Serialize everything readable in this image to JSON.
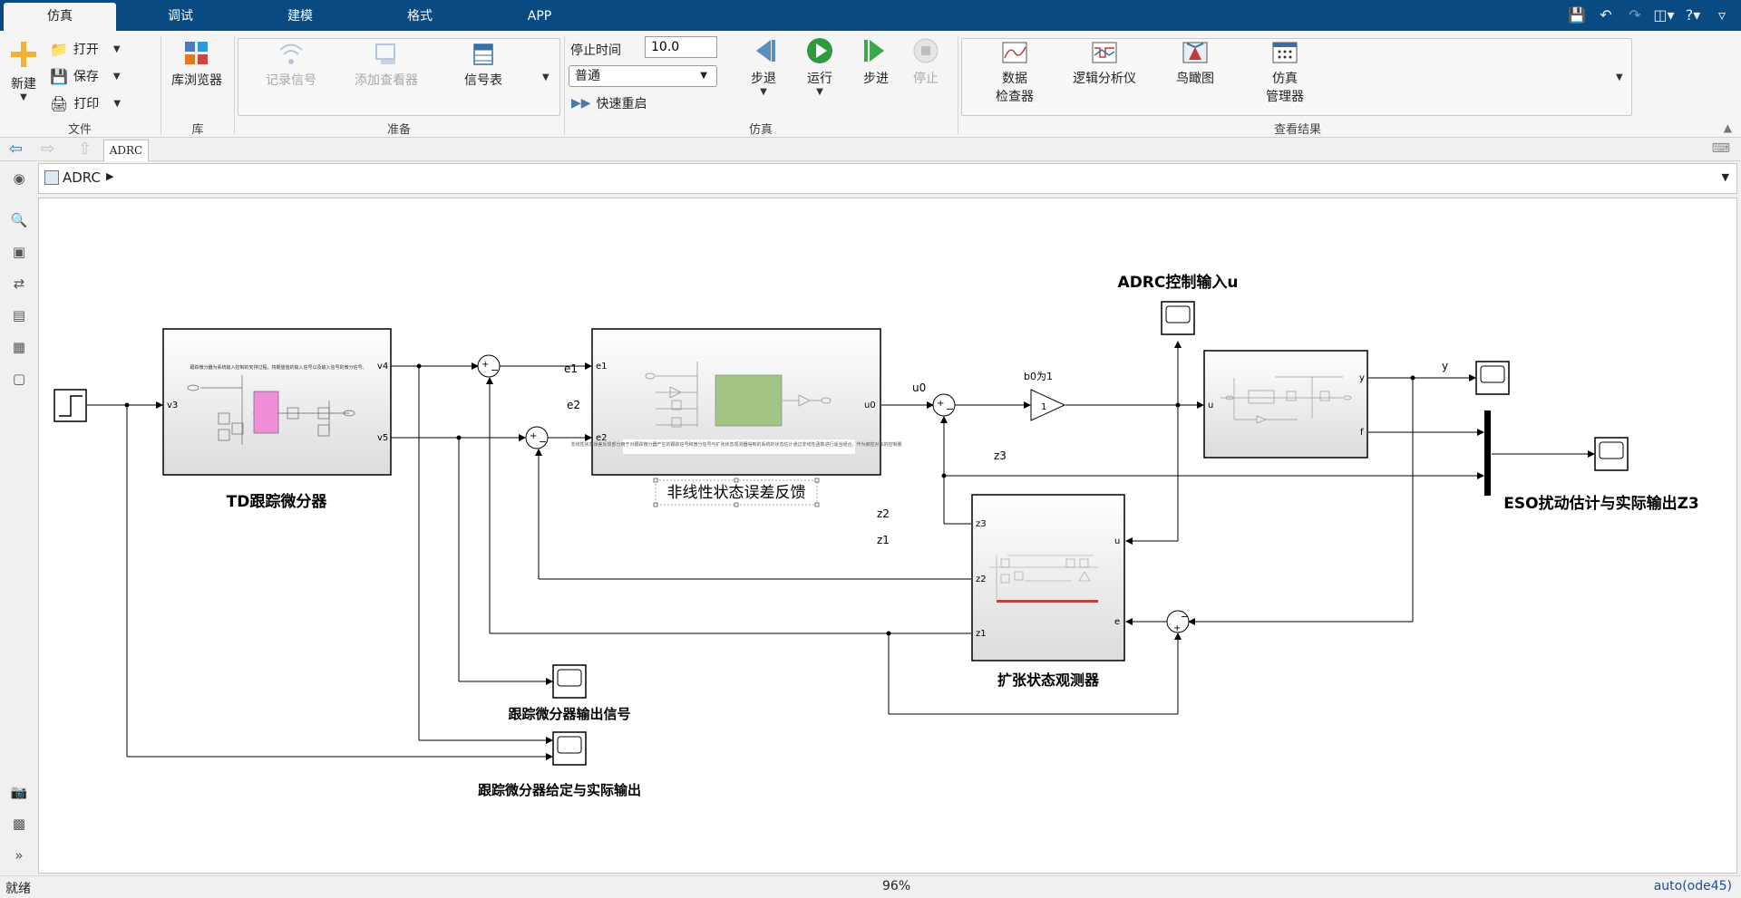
{
  "tabs": [
    "仿真",
    "调试",
    "建模",
    "格式",
    "APP"
  ],
  "ribbon": {
    "file": {
      "new": "新建",
      "open": "打开",
      "save": "保存",
      "print": "打印",
      "group": "文件"
    },
    "library": {
      "browser": "库浏览器",
      "group": "库"
    },
    "prepare": {
      "log_signal": "记录信号",
      "add_viewer": "添加查看器",
      "signal_table": "信号表",
      "group": "准备"
    },
    "simulate": {
      "stop_time_label": "停止时间",
      "stop_time_value": "10.0",
      "mode": "普通",
      "fast_restart": "快速重启",
      "step_back": "步退",
      "run": "运行",
      "step_forward": "步进",
      "stop": "停止",
      "group": "仿真"
    },
    "review": {
      "data_inspector_1": "数据",
      "data_inspector_2": "检查器",
      "logic_analyzer": "逻辑分析仪",
      "birds_eye": "鸟瞰图",
      "sim_manager_1": "仿真",
      "sim_manager_2": "管理器",
      "group": "查看结果"
    }
  },
  "nav": {
    "tab_label": "ADRC",
    "breadcrumb": "ADRC"
  },
  "model": {
    "td_block": "TD跟踪微分器",
    "td_desc": "跟踪微分器为系统输入控制的安排过程，将期望值的输入信号以及输入信号的微分信号。",
    "nlsef_block": "非线性状态误差反馈",
    "nlsef_desc": "非线性状态误差反馈部分用于对跟踪微分器产生的跟踪信号和微分信号与扩张状态观测器得到的系统的状态估计通过非线性函数进行适当组合，作为被控对象的控制量",
    "eso_block": "扩张状态观测器",
    "scope_adrc_u": "ADRC控制输入u",
    "scope_eso": "ESO扰动估计与实际输出Z3",
    "scope_td_out": "跟踪微分器输出信号",
    "scope_td_cmp": "跟踪微分器给定与实际输出",
    "gain_label": "b0为1",
    "gain_value": "1",
    "ports": {
      "v3": "v3",
      "v4": "v4",
      "v5": "v5",
      "e1": "e1",
      "e2": "e2",
      "u0": "u0",
      "z1": "z1",
      "z2": "z2",
      "z3": "z3",
      "u": "u",
      "e": "e",
      "y": "y",
      "f": "f"
    },
    "signals": {
      "e1": "e1",
      "e2": "e2",
      "u0": "u0",
      "y": "y",
      "z2": "z2",
      "z1": "z1",
      "z3": "z3"
    }
  },
  "status": {
    "left": "就绪",
    "zoom": "96%",
    "solver": "auto(ode45)"
  }
}
